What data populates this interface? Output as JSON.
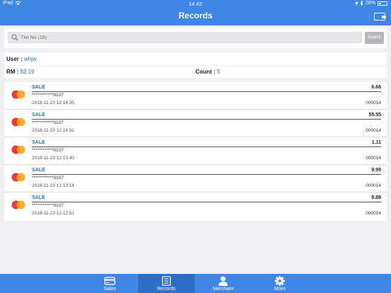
{
  "status_bar": {
    "device": "iPad",
    "time": "14:42",
    "battery": "28%"
  },
  "header": {
    "title": "Records",
    "wallet_icon": "wallet-icon"
  },
  "search": {
    "placeholder": "Txn No.(16)",
    "button_label": "Search"
  },
  "summary": {
    "user_label": "User :",
    "user_value": "whjw",
    "rm_label": "RM :",
    "rm_value": "82.19",
    "count_label": "Count :",
    "count_value": "5"
  },
  "records": [
    {
      "type": "SALE",
      "amount": "6.66",
      "card": "************9107",
      "datetime": "2018-11-23 12:14:35",
      "terminal": "000014"
    },
    {
      "type": "SALE",
      "amount": "55.55",
      "card": "************9107",
      "datetime": "2018-11-23 12:14:01",
      "terminal": "000014"
    },
    {
      "type": "SALE",
      "amount": "1.11",
      "card": "************9107",
      "datetime": "2018-11-23 12:13:40",
      "terminal": "000014"
    },
    {
      "type": "SALE",
      "amount": "9.99",
      "card": "************9107",
      "datetime": "2018-11-23 12:13:14",
      "terminal": "000014"
    },
    {
      "type": "SALE",
      "amount": "8.88",
      "card": "************9107",
      "datetime": "2018-11-23 12:12:51",
      "terminal": "000014"
    }
  ],
  "tabs": [
    {
      "label": "Sales",
      "icon": "credit-card-icon",
      "active": false
    },
    {
      "label": "Records",
      "icon": "records-icon",
      "active": true
    },
    {
      "label": "Merchant",
      "icon": "person-icon",
      "active": false
    },
    {
      "label": "More",
      "icon": "gear-icon",
      "active": false
    }
  ],
  "colors": {
    "primary": "#3f86e6",
    "active_tab": "#2d6fc8",
    "link": "#2f6fcf"
  }
}
